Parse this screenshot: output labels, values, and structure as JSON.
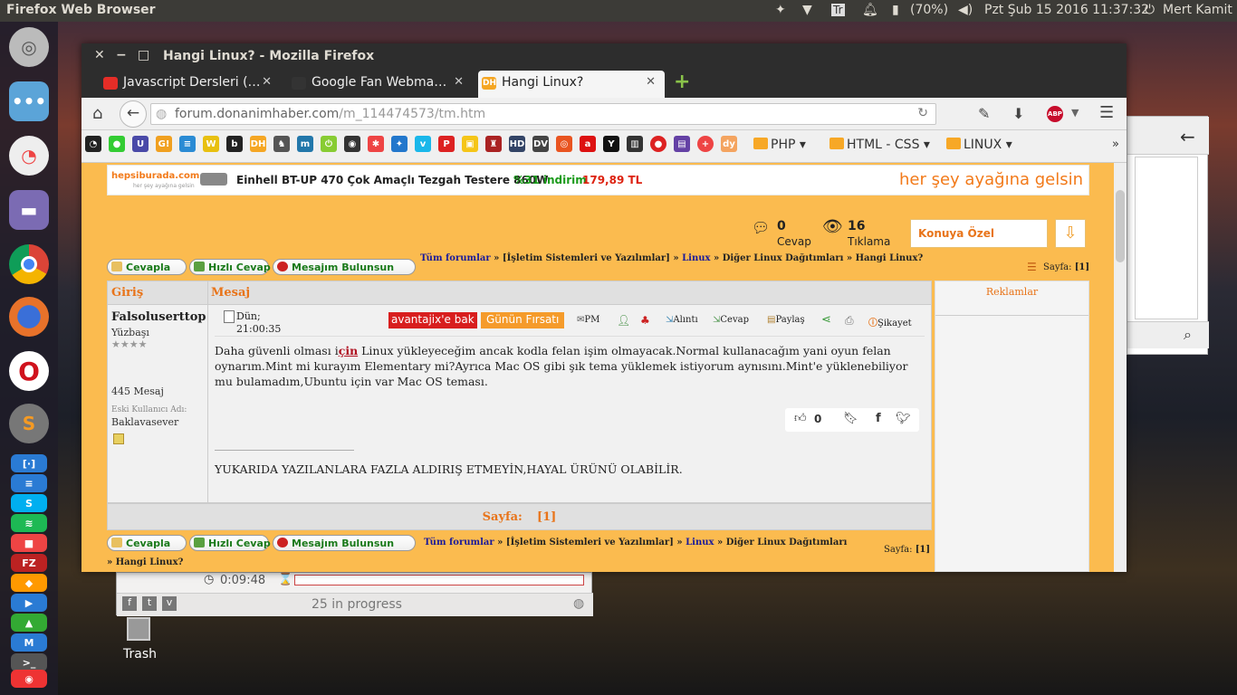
{
  "topbar": {
    "app_title": "Firefox Web Browser",
    "keyboard": "Tr",
    "battery": "(70%)",
    "datetime": "Pzt Şub 15 2016 11:37:32",
    "user": "Mert Kamit"
  },
  "launcher": {
    "items": [
      "ubuntu-dash",
      "messaging",
      "pie-app",
      "files",
      "chrome",
      "firefox",
      "opera",
      "sublime",
      "app-1",
      "app-2",
      "skype",
      "spotify",
      "app-3",
      "filezilla",
      "app-4",
      "app-5",
      "app-6",
      "app-7",
      "app-8",
      "app-9",
      "app-10"
    ]
  },
  "desktop": {
    "trash_label": "Trash"
  },
  "firefox": {
    "window_title": "Hangi Linux? - Mozilla Firefox",
    "tabs": [
      {
        "label": "Javascript Dersleri (…",
        "favicon_color": "#e52d27"
      },
      {
        "label": "Google Fan Webma…",
        "favicon_color": "#333"
      },
      {
        "label": "Hangi Linux?",
        "favicon_color": "#f5a623",
        "fav_text": "DH"
      }
    ],
    "url_domain": "forum.donanimhaber.com",
    "url_path": "/m_114474573/tm.htm",
    "bookmark_folders": [
      "PHP ▾",
      "HTML - CSS ▾",
      "LINUX ▾"
    ]
  },
  "page": {
    "ad": {
      "brand": "hepsiburada.com",
      "brand_sub": "her şey ayağına gelsin",
      "product": "Einhell BT-UP 470 Çok Amaçlı Tezgah Testere 860W",
      "discount": "%31 indirim",
      "price": "179,89 TL",
      "slogan": "her şey ayağına gelsin"
    },
    "stats": {
      "reply_count": "0",
      "reply_label": "Cevap",
      "view_count": "16",
      "view_label": "Tıklama",
      "topic_button": "Konuya Özel"
    },
    "buttons": {
      "reply": "Cevapla",
      "quick_reply": "Hızlı Cevap",
      "my_message": "Mesajım Bulunsun"
    },
    "breadcrumb": {
      "all": "Tüm forumlar",
      "sep": "»",
      "os": "[İşletim Sistemleri ve Yazılımlar]",
      "linux": "Linux",
      "distros": "Diğer Linux Dağıtımları",
      "topic": "Hangi Linux?"
    },
    "page_label": "Sayfa:",
    "page_num": "[1]",
    "table": {
      "col_login": "Giriş",
      "col_message": "Mesaj"
    },
    "user": {
      "name": "Falsoluserttop",
      "rank": "Yüzbaşı",
      "stars": "★★★★",
      "messages": "445 Mesaj",
      "old_label": "Eski Kullanıcı Adı:",
      "old_name": "Baklavasever"
    },
    "post": {
      "date": "Dün;",
      "time": "21:00:35",
      "promo1": "avantajix'e bak",
      "promo2": "Günün Fırsatı",
      "actions": [
        "PM",
        "Alıntı",
        "Cevap",
        "Paylaş",
        "Şikayet"
      ],
      "text_pre": "Daha güvenli olması i",
      "text_link": "çin",
      "text_post": " Linux yükleyeceğim ancak kodla felan işim olmayacak.Normal kullanacağım yani oyun felan oynarım.Mint mi kurayım Elementary mi?Ayrıca Mac OS gibi şık tema yüklemek istiyorum aynısını.Mint'e yüklenebiliyor mu bulamadım,Ubuntu için var Mac OS teması.",
      "likes": "0",
      "signature_line": "____________________________",
      "signature": "YUKARIDA YAZILANLARA FAZLA ALDIRIŞ ETMEYİN,HAYAL ÜRÜNÜ OLABİLİR."
    },
    "pager_label": "Sayfa:",
    "pager_num": "[1]",
    "sidebar_title": "Reklamlar"
  },
  "bg_transfer": {
    "time": "0:09:48",
    "status": "25 in progress"
  }
}
